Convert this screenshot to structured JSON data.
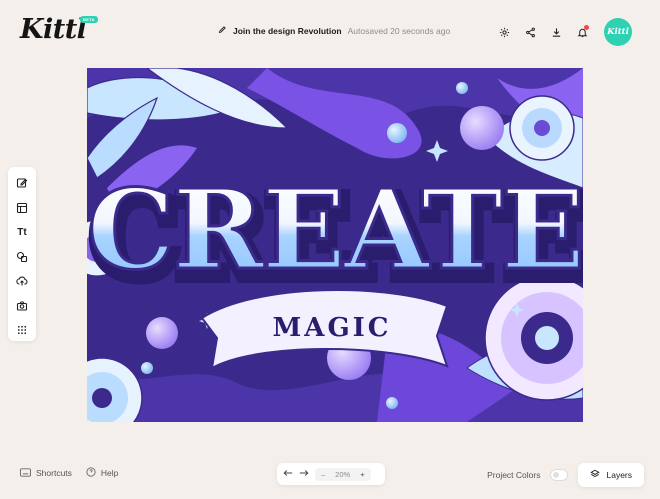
{
  "app": {
    "logo": "Kittl",
    "badge": "BETA"
  },
  "header": {
    "project_name": "Join the design Revolution",
    "autosave": "Autosaved 20 seconds ago",
    "avatar_label": "Kittl"
  },
  "toolbar": {
    "items": [
      {
        "icon": "edit-icon"
      },
      {
        "icon": "layout-icon"
      },
      {
        "icon": "text-icon",
        "label": "Tt"
      },
      {
        "icon": "shapes-icon"
      },
      {
        "icon": "upload-icon"
      },
      {
        "icon": "camera-icon"
      },
      {
        "icon": "grid-icon"
      }
    ]
  },
  "artwork": {
    "line1": "CREATE",
    "line2": "MAGIC"
  },
  "footer": {
    "shortcuts_label": "Shortcuts",
    "help_label": "Help",
    "zoom_value": "20%",
    "zoom_minus": "–",
    "zoom_plus": "+",
    "project_colors_label": "Project Colors",
    "layers_label": "Layers"
  },
  "colors": {
    "accent": "#2fd1b3",
    "background": "#f4efea",
    "art_dark": "#3b2a8c",
    "art_violet": "#8a63f0",
    "art_light": "#c9e6ff"
  }
}
